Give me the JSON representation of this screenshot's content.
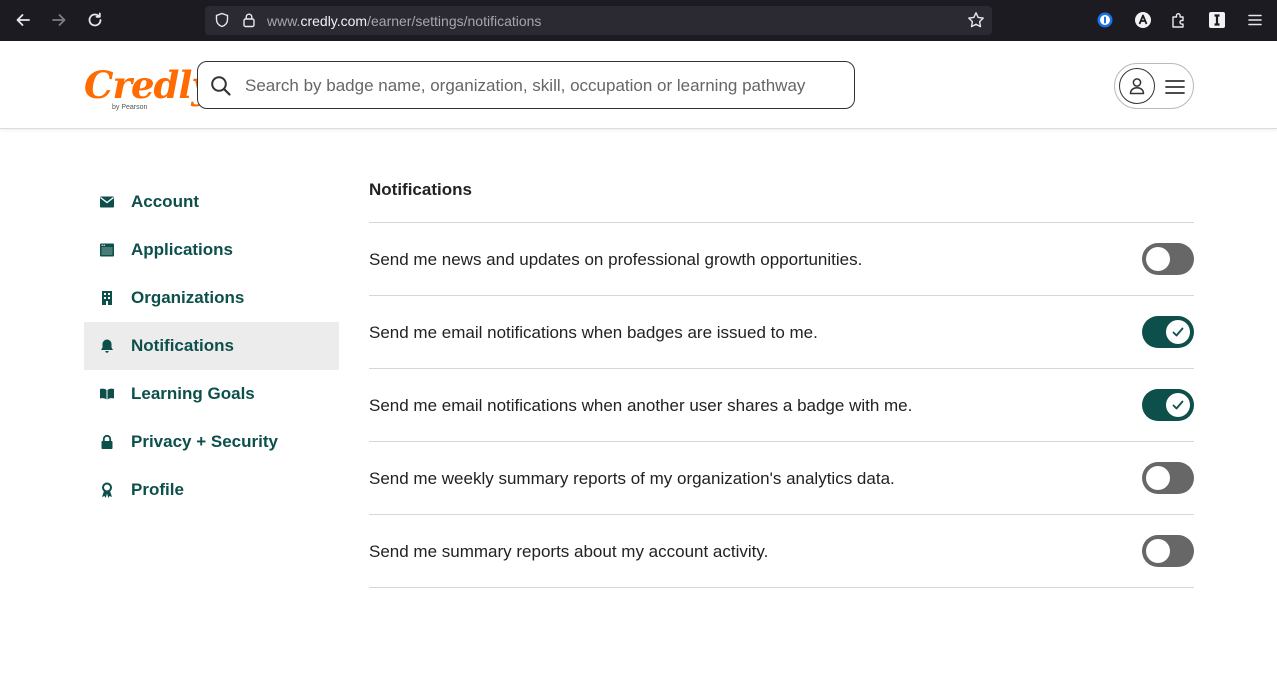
{
  "browser": {
    "url_prefix": "www.",
    "url_domain": "credly.com",
    "url_path": "/earner/settings/notifications",
    "icons": [
      "back-arrow-icon",
      "forward-arrow-icon",
      "reload-icon",
      "shield-icon",
      "lock-icon",
      "bookmark-star-icon",
      "password-manager-icon",
      "account-extension-icon",
      "puzzle-icon",
      "instapaper-icon",
      "menu-icon"
    ]
  },
  "header": {
    "logo_text": "Credly",
    "logo_subtext": "by Pearson",
    "search_placeholder": "Search by badge name, organization, skill, occupation or learning pathway"
  },
  "sidebar": {
    "items": [
      {
        "label": "Account",
        "icon": "envelope-icon",
        "active": false
      },
      {
        "label": "Applications",
        "icon": "window-icon",
        "active": false
      },
      {
        "label": "Organizations",
        "icon": "building-icon",
        "active": false
      },
      {
        "label": "Notifications",
        "icon": "bell-icon",
        "active": true
      },
      {
        "label": "Learning Goals",
        "icon": "book-icon",
        "active": false
      },
      {
        "label": "Privacy + Security",
        "icon": "lock-icon",
        "active": false
      },
      {
        "label": "Profile",
        "icon": "award-icon",
        "active": false
      }
    ]
  },
  "main": {
    "title": "Notifications",
    "notifications": [
      {
        "text": "Send me news and updates on professional growth opportunities.",
        "enabled": false
      },
      {
        "text": "Send me email notifications when badges are issued to me.",
        "enabled": true
      },
      {
        "text": "Send me email notifications when another user shares a badge with me.",
        "enabled": true
      },
      {
        "text": "Send me weekly summary reports of my organization's analytics data.",
        "enabled": false
      },
      {
        "text": "Send me summary reports about my account activity.",
        "enabled": false
      }
    ]
  },
  "colors": {
    "brand_orange": "#ff6b00",
    "accent_teal": "#0d4f4a",
    "toggle_off": "#676767"
  }
}
